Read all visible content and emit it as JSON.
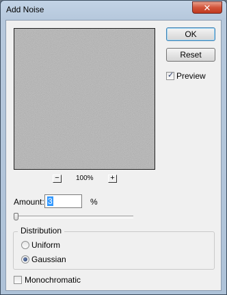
{
  "window": {
    "title": "Add Noise",
    "close_glyph": "✕"
  },
  "preview": {
    "zoom_out_label": "−",
    "zoom_in_label": "+",
    "zoom_level": "100%"
  },
  "buttons": {
    "ok_label": "OK",
    "reset_label": "Reset"
  },
  "preview_toggle": {
    "label": "Preview",
    "checked": true
  },
  "amount": {
    "label": "Amount:",
    "value": "3",
    "unit": "%",
    "slider_fraction": 0.008
  },
  "distribution": {
    "title": "Distribution",
    "options": [
      {
        "label": "Uniform",
        "selected": false
      },
      {
        "label": "Gaussian",
        "selected": true
      }
    ]
  },
  "monochromatic": {
    "label": "Monochromatic",
    "checked": false
  },
  "colors": {
    "preview_gray": "#797979",
    "title_bar": "#b9cbe0",
    "close_button": "#c94a31"
  }
}
